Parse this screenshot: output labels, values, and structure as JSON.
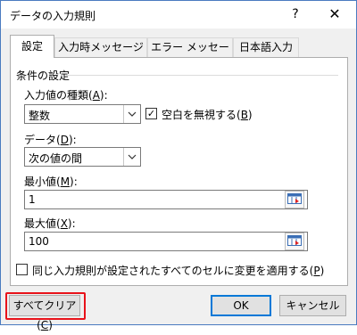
{
  "window": {
    "title": "データの入力規則",
    "help_label": "?",
    "close_label": "✕"
  },
  "tabs": [
    {
      "label": "設定",
      "active": true
    },
    {
      "label": "入力時メッセージ",
      "active": false
    },
    {
      "label": "エラー メッセージ",
      "active": false
    },
    {
      "label": "日本語入力",
      "active": false
    }
  ],
  "settings": {
    "group_title": "条件の設定",
    "allow_label": "入力値の種類(",
    "allow_key": "A",
    "allow_value": "整数",
    "ignore_blank_label": "空白を無視する(",
    "ignore_blank_key": "B",
    "ignore_blank_checked": true,
    "data_label": "データ(",
    "data_key": "D",
    "data_value": "次の値の間",
    "min_label": "最小値(",
    "min_key": "M",
    "min_value": "1",
    "max_label": "最大値(",
    "max_key": "X",
    "max_value": "100",
    "apply_all_label": "同じ入力規則が設定されたすべてのセルに変更を適用する(",
    "apply_all_key": "P",
    "apply_all_checked": false
  },
  "buttons": {
    "clear_all_label": "すべてクリア(",
    "clear_all_key": "C",
    "ok_label": "OK",
    "cancel_label": "キャンセル"
  },
  "colors": {
    "highlight": "#e8121a",
    "window_border": "#4a7bc0",
    "default_button": "#0078d7"
  }
}
